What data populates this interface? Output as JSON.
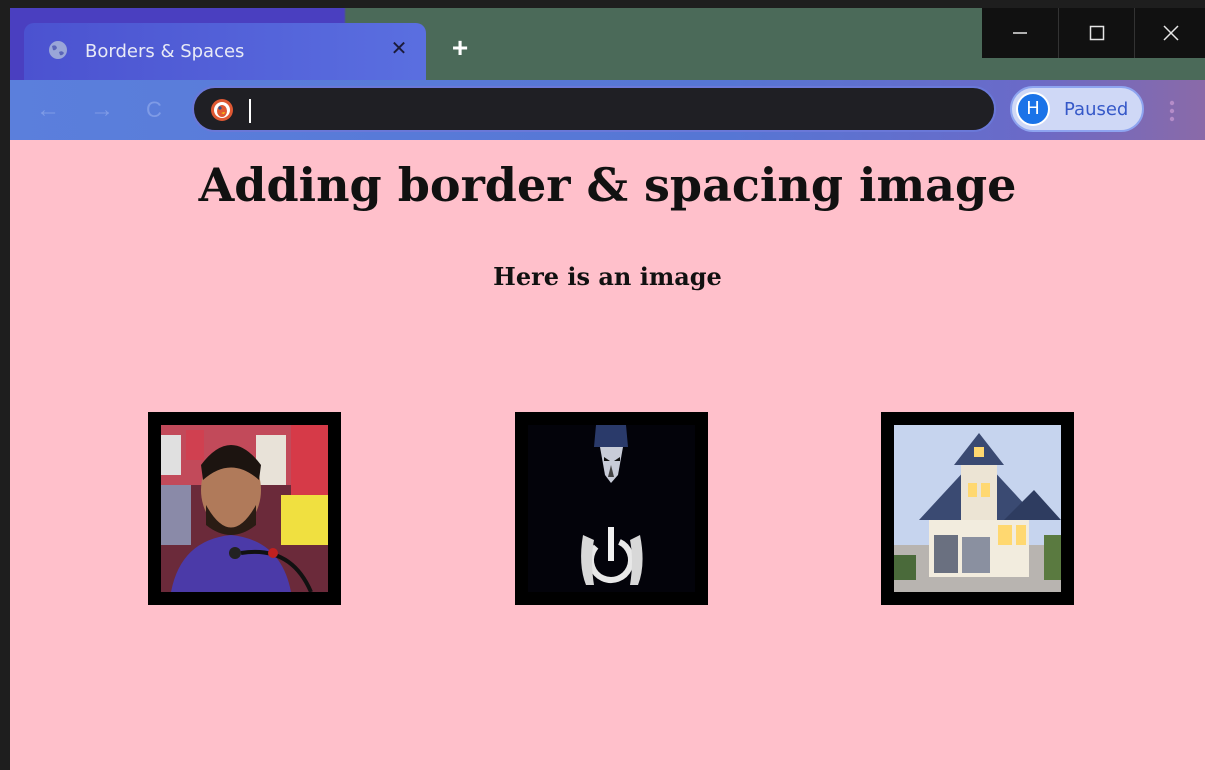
{
  "browser": {
    "tab": {
      "title": "Borders & Spaces",
      "close_glyph": "✕"
    },
    "new_tab_glyph": "+",
    "window_controls": {
      "minimize": "—",
      "maximize": "☐",
      "close": "✕"
    },
    "nav": {
      "back": "←",
      "forward": "→",
      "reload": "C"
    },
    "address_bar": {
      "value": "",
      "placeholder": "",
      "search_engine_icon": "duckduckgo-icon"
    },
    "profile": {
      "initial": "H",
      "status": "Paused"
    },
    "menu_icon": "kebab-menu-icon"
  },
  "page": {
    "background_color": "#ffc0cb",
    "heading": "Adding border & spacing image",
    "subheading": "Here is an image",
    "images": [
      {
        "name": "man-at-press-conference-image",
        "border_color": "#000000"
      },
      {
        "name": "hooded-figure-power-icon-image",
        "border_color": "#000000"
      },
      {
        "name": "house-image",
        "border_color": "#000000"
      }
    ]
  }
}
